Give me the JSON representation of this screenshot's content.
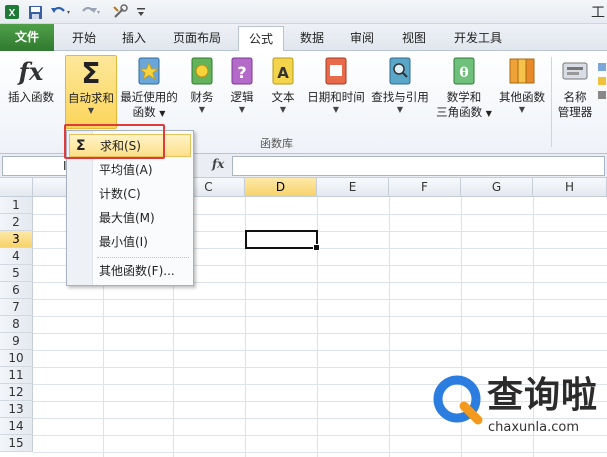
{
  "window": {
    "title_fragment": "工"
  },
  "ribbon_tabs": [
    "文件",
    "开始",
    "插入",
    "页面布局",
    "公式",
    "数据",
    "审阅",
    "视图",
    "开发工具"
  ],
  "active_tab": "公式",
  "ribbon_buttons": {
    "insert_function": "插入函数",
    "autosum": "自动求和",
    "recent_line1": "最近使用的",
    "recent_line2": "函数",
    "financial": "财务",
    "logical": "逻辑",
    "text": "文本",
    "datetime": "日期和时间",
    "lookup": "查找与引用",
    "math_line1": "数学和",
    "math_line2": "三角函数",
    "other": "其他函数",
    "name_mgr_line1": "名称",
    "name_mgr_line2": "管理器"
  },
  "group_label": "函数库",
  "formula_bar": {
    "namebox_fragment": "I",
    "fx": "fx"
  },
  "columns": [
    "C",
    "D",
    "E",
    "F",
    "G",
    "H"
  ],
  "selected_column": "D",
  "rows": [
    "1",
    "2",
    "3",
    "4",
    "5",
    "6",
    "7",
    "8",
    "9",
    "10",
    "11",
    "12",
    "13",
    "14",
    "15"
  ],
  "selected_row": "3",
  "autosum_menu": {
    "items": [
      "求和(S)",
      "平均值(A)",
      "计数(C)",
      "最大值(M)",
      "最小值(I)",
      "其他函数(F)..."
    ],
    "highlighted": "求和(S)",
    "sigma": "Σ"
  },
  "watermark": {
    "name": "查询啦",
    "url": "chaxunla.com"
  },
  "colors": {
    "file_tab": "#3c8c3a",
    "highlight_box": "#e03a3a",
    "selection": "#f8d26a"
  }
}
